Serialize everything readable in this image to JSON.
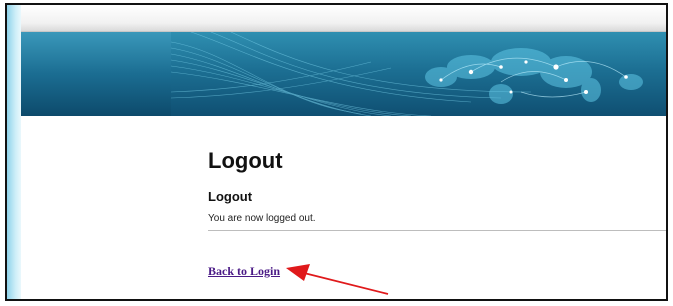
{
  "page": {
    "title": "Logout",
    "section_heading": "Logout",
    "message": "You are now logged out.",
    "back_link": "Back to Login"
  },
  "colors": {
    "banner_dark": "#0f4f72",
    "banner_light": "#2f8fb1",
    "link": "#4a1a86",
    "annotation_arrow": "#e0191b"
  },
  "annotation": {
    "type": "arrow",
    "target": "back-to-login-link"
  }
}
